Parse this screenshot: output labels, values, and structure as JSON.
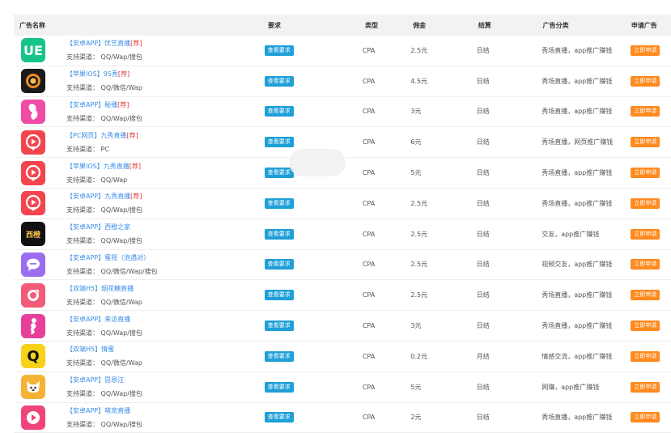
{
  "headers": {
    "name": "广告名称",
    "requirement": "要求",
    "type": "类型",
    "commission": "佣金",
    "settlement": "结算",
    "category": "广告分类",
    "apply": "申请广告"
  },
  "view_button_label": "查看要求",
  "apply_button_label": "立即申请",
  "rows": [
    {
      "icon": "ue-logo-icon",
      "icon_bg": "#16c38a",
      "icon_text": "UE",
      "title": "【安卓APP】优艺直播",
      "tag": "[荐]",
      "channels": "支持渠道： QQ/Wap/搜包",
      "type": "CPA",
      "commission": "2.5元",
      "settlement": "日结",
      "category": "秀场直播，app推广赚钱"
    },
    {
      "icon": "swirl-logo-icon",
      "icon_bg": "#1a1a1a",
      "icon_text": "",
      "title": "【苹果IOS】95秀",
      "tag": "[荐]",
      "channels": "支持渠道： QQ/微信/Wap",
      "type": "CPA",
      "commission": "4.5元",
      "settlement": "日结",
      "category": "秀场直播，app推广赚钱"
    },
    {
      "icon": "girl-logo-icon",
      "icon_bg": "#f04ca7",
      "icon_text": "",
      "title": "【安卓APP】秘播",
      "tag": "[荐]",
      "channels": "支持渠道： QQ/Wap/搜包",
      "type": "CPA",
      "commission": "3元",
      "settlement": "日结",
      "category": "秀场直播，app推广赚钱"
    },
    {
      "icon": "play-pin-logo-icon",
      "icon_bg": "#f4454f",
      "icon_text": "",
      "title": "【PC网页】九秀直播",
      "tag": "[荐]",
      "channels": "支持渠道：  PC",
      "type": "CPA",
      "commission": "6元",
      "settlement": "日结",
      "category": "秀场直播，网页推广赚钱"
    },
    {
      "icon": "play-pin-logo-icon",
      "icon_bg": "#f4454f",
      "icon_text": "",
      "title": "【苹果IOS】九秀直播",
      "tag": "[荐]",
      "channels": "支持渠道： QQ/Wap",
      "type": "CPA",
      "commission": "5元",
      "settlement": "日结",
      "category": "秀场直播，app推广赚钱"
    },
    {
      "icon": "play-pin-logo-icon",
      "icon_bg": "#f4454f",
      "icon_text": "",
      "title": "【安卓APP】九秀直播",
      "tag": "[荐]",
      "channels": "支持渠道： QQ/Wap/搜包",
      "type": "CPA",
      "commission": "2.5元",
      "settlement": "日结",
      "category": "秀场直播，app推广赚钱"
    },
    {
      "icon": "xijin-logo-icon",
      "icon_bg": "#111111",
      "icon_text": "西橙",
      "title": "【安卓APP】西橙之家",
      "tag": "",
      "channels": "支持渠道： QQ/Wap/搜包",
      "type": "CPA",
      "commission": "2.5元",
      "settlement": "日结",
      "category": "交友，app推广赚钱"
    },
    {
      "icon": "chat-bubble-logo-icon",
      "icon_bg": "#9b6ef0",
      "icon_text": "",
      "title": "【安卓APP】蜜视（泡遇对）",
      "tag": "",
      "channels": "支持渠道： QQ/微信/Wap/搜包",
      "type": "CPA",
      "commission": "2.5元",
      "settlement": "日结",
      "category": "视频交友，app推广赚钱"
    },
    {
      "icon": "flower-logo-icon",
      "icon_bg": "#f25b78",
      "icon_text": "",
      "title": "【双端H5】烟花糖直播",
      "tag": "",
      "channels": "支持渠道： QQ/微信/Wap",
      "type": "CPA",
      "commission": "2.5元",
      "settlement": "日结",
      "category": "秀场直播，app推广赚钱"
    },
    {
      "icon": "dancer-logo-icon",
      "icon_bg": "#e8409a",
      "icon_text": "",
      "title": "【安卓APP】来访直播",
      "tag": "",
      "channels": "支持渠道： QQ/Wap/搜包",
      "type": "CPA",
      "commission": "3元",
      "settlement": "日结",
      "category": "秀场直播，app推广赚钱"
    },
    {
      "icon": "q-logo-icon",
      "icon_bg": "#f7d21b",
      "icon_text": "Q",
      "title": "【双端H5】情蜜",
      "tag": "",
      "channels": "支持渠道： QQ/微信/Wap",
      "type": "CPA",
      "commission": "0.2元",
      "settlement": "月结",
      "category": "情感交流，app推广赚钱"
    },
    {
      "icon": "dog-logo-icon",
      "icon_bg": "#f5b335",
      "icon_text": "",
      "title": "【安卓APP】昆恩汪",
      "tag": "",
      "channels": "支持渠道： QQ/Wap/搜包",
      "type": "CPA",
      "commission": "5元",
      "settlement": "日结",
      "category": "网赚，app推广赚钱"
    },
    {
      "icon": "play-heart-logo-icon",
      "icon_bg": "#f0457a",
      "icon_text": "",
      "title": "【安卓APP】萌宠直播",
      "tag": "",
      "channels": "支持渠道： QQ/Wap/搜包",
      "type": "CPA",
      "commission": "2元",
      "settlement": "日结",
      "category": "秀场直播，app推广赚钱"
    }
  ]
}
